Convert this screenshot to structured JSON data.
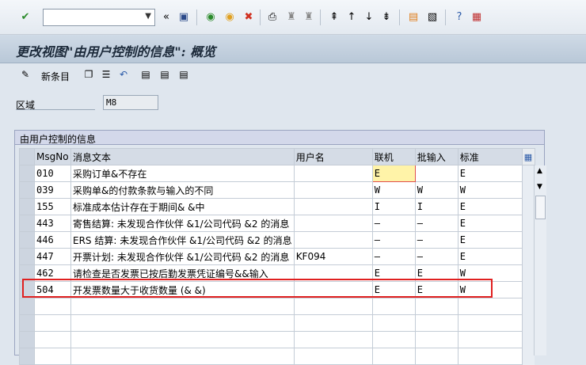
{
  "toolbar": {
    "command_value": "",
    "icons": [
      "check-icon",
      "back-double-arrow-icon",
      "save-icon",
      "back-icon",
      "exit-icon",
      "cancel-icon",
      "print-icon",
      "find-icon",
      "find-next-icon",
      "first-page-icon",
      "prev-page-icon",
      "next-page-icon",
      "last-page-icon",
      "new-session-icon",
      "shortcut-icon",
      "help-icon",
      "customize-layout-icon"
    ]
  },
  "title": "更改视图\"由用户控制的信息\": 概览",
  "appbar": {
    "new_entries": "新条目"
  },
  "field": {
    "label": "区域",
    "value": "M8"
  },
  "group": {
    "title": "由用户控制的信息",
    "columns": [
      "MsgNo",
      "消息文本",
      "用户名",
      "联机",
      "批输入",
      "标准"
    ],
    "rows": [
      {
        "msgno": "010",
        "text": "采购订单&不存在",
        "user": "",
        "online": "E",
        "batch": "",
        "standard": "E"
      },
      {
        "msgno": "039",
        "text": "采购单&的付款条款与输入的不同",
        "user": "",
        "online": "W",
        "batch": "W",
        "standard": "W"
      },
      {
        "msgno": "155",
        "text": "标准成本估计存在于期间& &中",
        "user": "",
        "online": "I",
        "batch": "I",
        "standard": "E"
      },
      {
        "msgno": "443",
        "text": "寄售结算: 未发现合作伙伴 &1/公司代码 &2 的消息",
        "user": "",
        "online": "–",
        "batch": "–",
        "standard": "E"
      },
      {
        "msgno": "446",
        "text": "ERS 结算: 未发现合作伙伴 &1/公司代码 &2 的消息",
        "user": "",
        "online": "–",
        "batch": "–",
        "standard": "E"
      },
      {
        "msgno": "447",
        "text": "开票计划: 未发现合作伙伴 &1/公司代码 &2 的消息",
        "user": "KF094",
        "online": "–",
        "batch": "–",
        "standard": "E"
      },
      {
        "msgno": "462",
        "text": "请检查是否发票已按后勤发票凭证编号&&输入",
        "user": "",
        "online": "E",
        "batch": "E",
        "standard": "W"
      },
      {
        "msgno": "504",
        "text": "开发票数量大于收货数量 (& &)",
        "user": "",
        "online": "E",
        "batch": "E",
        "standard": "W"
      }
    ]
  },
  "colors": {
    "highlight_border": "#e02020",
    "title_bg": "#c4d1df"
  }
}
